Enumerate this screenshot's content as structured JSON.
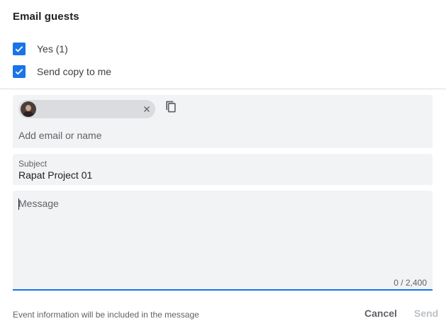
{
  "dialog": {
    "title": "Email guests"
  },
  "options": [
    {
      "label": "Yes (1)",
      "checked": true
    },
    {
      "label": "Send copy to me",
      "checked": true
    }
  ],
  "recipients": {
    "chip_avatar": "avatar-photo",
    "chip_close_icon": "close-icon",
    "copy_icon": "copy-icon",
    "add_placeholder": "Add email or name"
  },
  "subject": {
    "label": "Subject",
    "value": "Rapat Project 01"
  },
  "message": {
    "placeholder": "Message",
    "counter": "0 / 2,400"
  },
  "footer": {
    "note": "Event information will be included in the message",
    "cancel_label": "Cancel",
    "send_label": "Send"
  },
  "colors": {
    "accent": "#1a73e8",
    "field_bg": "#f1f3f4",
    "disabled_text": "#bdc1c6"
  }
}
